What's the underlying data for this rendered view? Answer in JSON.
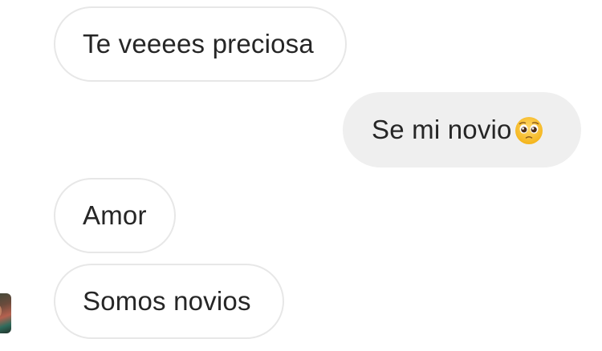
{
  "conversation": {
    "messages": [
      {
        "direction": "received",
        "text": "Te veeees preciosa"
      },
      {
        "direction": "sent",
        "text": "Se mi novio",
        "emoji": "pleading-face-icon"
      },
      {
        "direction": "received",
        "text": "Amor"
      },
      {
        "direction": "received",
        "text": "Somos novios"
      }
    ]
  },
  "colors": {
    "received_bubble_bg": "#ffffff",
    "received_bubble_border": "#e7e7e7",
    "sent_bubble_bg": "#efefef",
    "text": "#262626"
  }
}
